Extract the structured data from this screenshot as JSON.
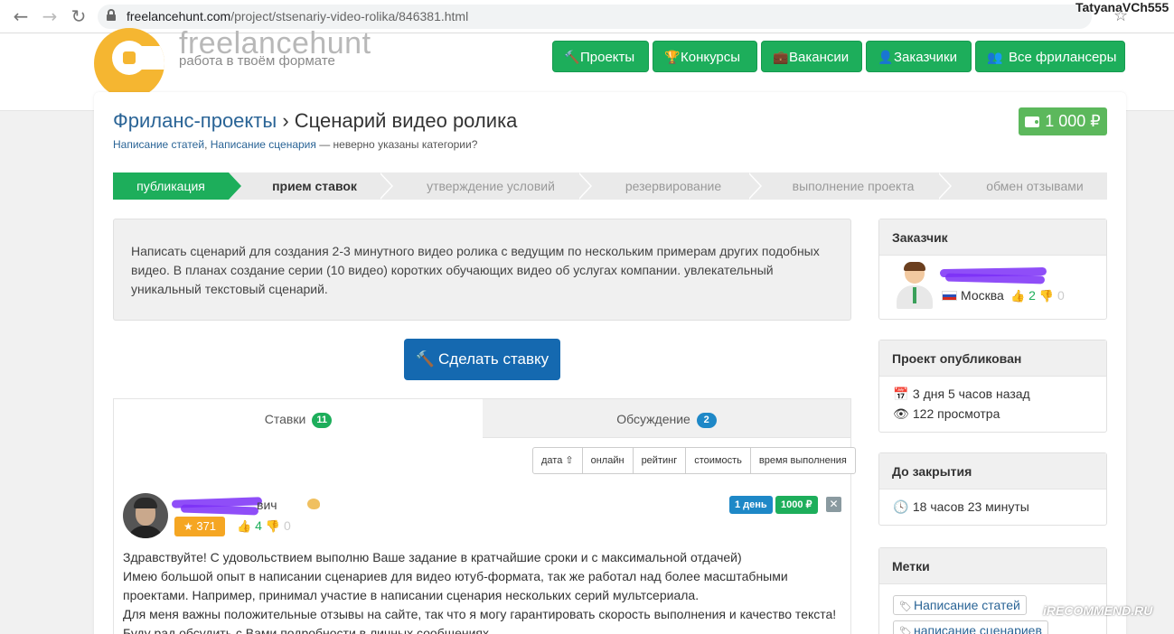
{
  "browser": {
    "url_host": "freelancehunt.com",
    "url_path": "/project/stsenariy-video-rolika/846381.html",
    "user": "TatyanaVCh555",
    "back_icon": "arrow-left-icon",
    "forward_icon": "arrow-right-icon",
    "reload_icon": "reload-icon"
  },
  "site": {
    "logo_name": "freelancehunt",
    "logo_tagline": "работа в твоём формате",
    "brand_color": "#1dae5b",
    "nav": [
      {
        "label": "Проекты",
        "icon": "gavel-icon"
      },
      {
        "label": "Конкурсы",
        "icon": "trophy-icon"
      },
      {
        "label": "Вакансии",
        "icon": "briefcase-icon"
      },
      {
        "label": "Заказчики",
        "icon": "user-icon"
      },
      {
        "label": "Все фрилансеры",
        "icon": "users-icon"
      }
    ]
  },
  "project": {
    "breadcrumb_root": "Фриланс-проекты",
    "breadcrumb_sep": "›",
    "title": "Сценарий видео ролика",
    "category_1": "Написание статей",
    "category_2": "Написание сценария",
    "category_note": " — неверно указаны категории?",
    "budget": "1 000 ₽",
    "steps": [
      "публикация",
      "прием ставок",
      "утверждение условий",
      "резервирование",
      "выполнение проекта",
      "обмен отзывами"
    ],
    "description": "Написать сценарий для создания 2-3 минутного видео ролика с ведущим по нескольким примерам других подобных видео. В планах создание серии (10 видео) коротких обучающих видео об услугах компании.  увлекательный уникальный текстовый сценарий.",
    "bid_button": "Сделать ставку"
  },
  "tabs": {
    "bids_label": "Ставки",
    "bids_count": "11",
    "discussion_label": "Обсуждение",
    "discussion_count": "2"
  },
  "sort": [
    "дата ⇧",
    "онлайн",
    "рейтинг",
    "стоимость",
    "время выполнения"
  ],
  "bid": {
    "name_tail": "вич",
    "rating": "371",
    "positive": "4",
    "negative": "0",
    "days": "1 день",
    "price": "1000 ₽",
    "text_lines": [
      "Здравствуйте! С удовольствием выполню Ваше задание в кратчайшие сроки и с максимальной отдачей)",
      "Имею большой опыт в написании сценариев для видео ютуб-формата, так же работал над более масштабными",
      "проектами. Например, принимал участие в написании сценария нескольких серий мультсериала.",
      "Для меня важны положительные отзывы на сайте, так что я могу гарантировать скорость выполнения и качество текста!",
      "Буду рад обсудить с Вами подробности в личных сообщениях."
    ]
  },
  "sidebar": {
    "customer_title": "Заказчик",
    "customer_city": "Москва",
    "customer_positive": "2",
    "customer_negative": "0",
    "published_title": "Проект опубликован",
    "published_ago": "3 дня 5 часов назад",
    "views": "122 просмотра",
    "closing_title": "До закрытия",
    "closing_time": "18 часов 23 минуты",
    "tags_title": "Метки",
    "tags": [
      "Написание статей",
      "написание сценариев"
    ]
  },
  "watermark": "iRECOMMEND.RU"
}
